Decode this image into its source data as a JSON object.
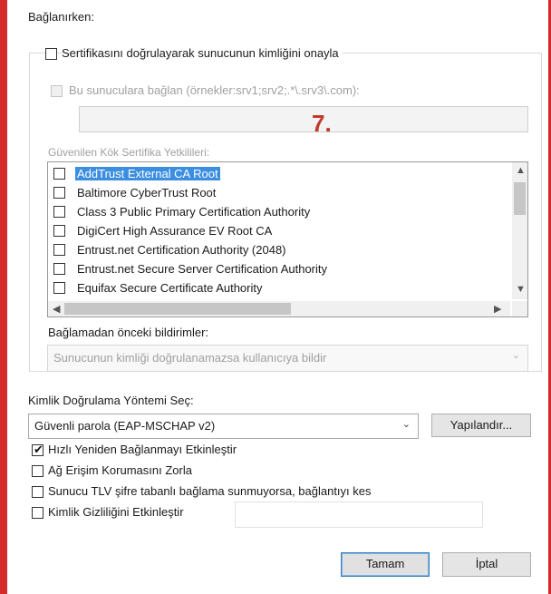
{
  "header": {
    "connecting_label": "Bağlanırken:"
  },
  "verify_server_checkbox": {
    "label": "Sertifikasını doğrulayarak sunucunun kimliğini onayla",
    "checked": false
  },
  "connect_servers": {
    "label": "Bu sunuculara bağlan (örnekler:srv1;srv2;.*\\.srv3\\.com):",
    "value": ""
  },
  "annotation": {
    "step": "7."
  },
  "trusted_roots": {
    "label": "Güvenilen Kök Sertifika Yetkilileri:",
    "items": [
      {
        "label": "AddTrust External CA Root",
        "checked": false,
        "selected": true
      },
      {
        "label": "Baltimore CyberTrust Root",
        "checked": false,
        "selected": false
      },
      {
        "label": "Class 3 Public Primary Certification Authority",
        "checked": false,
        "selected": false
      },
      {
        "label": "DigiCert High Assurance EV Root CA",
        "checked": false,
        "selected": false
      },
      {
        "label": "Entrust.net Certification Authority (2048)",
        "checked": false,
        "selected": false
      },
      {
        "label": "Entrust.net Secure Server Certification Authority",
        "checked": false,
        "selected": false
      },
      {
        "label": "Equifax Secure Certificate Authority",
        "checked": false,
        "selected": false
      }
    ]
  },
  "pre_connect": {
    "label": "Bağlamadan önceki bildirimler:",
    "value": "Sunucunun kimliği doğrulanamazsa kullanıcıya bildir"
  },
  "auth_method": {
    "label": "Kimlik Doğrulama Yöntemi Seç:",
    "value": "Güvenli parola (EAP-MSCHAP v2)",
    "configure_label": "Yapılandır..."
  },
  "options": {
    "fast_reconnect": {
      "label": "Hızlı Yeniden Bağlanmayı Etkinleştir",
      "checked": true
    },
    "nap": {
      "label": "Ağ Erişim Korumasını Zorla",
      "checked": false
    },
    "tlv": {
      "label": "Sunucu TLV şifre tabanlı bağlama sunmuyorsa, bağlantıyı kes",
      "checked": false
    },
    "privacy": {
      "label": "Kimlik Gizliliğini Etkinleştir",
      "checked": false,
      "value": ""
    }
  },
  "buttons": {
    "ok": "Tamam",
    "cancel": "İptal"
  },
  "colors": {
    "border_red": "#d42a2a",
    "selection": "#3b8ee0",
    "annotation": "#c0392b"
  }
}
